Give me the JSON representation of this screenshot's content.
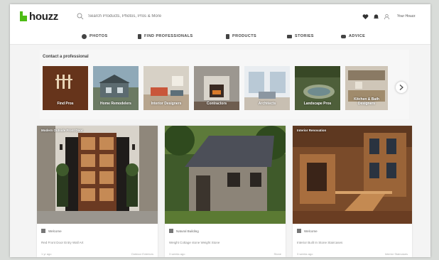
{
  "app": {
    "logo_text": "houzz",
    "search_placeholder": "Search Products, Photos, Pros & More"
  },
  "topbar": {
    "join_label": "Your Houzz",
    "icons": [
      "heart-icon",
      "bell-icon",
      "user-icon"
    ]
  },
  "nav": {
    "items": [
      {
        "label": "PHOTOS",
        "icon": "camera-icon"
      },
      {
        "label": "FIND PROFESSIONALS",
        "icon": "person-icon"
      },
      {
        "label": "PRODUCTS",
        "icon": "lamp-icon"
      },
      {
        "label": "STORIES",
        "icon": "book-icon"
      },
      {
        "label": "ADVICE",
        "icon": "chat-icon"
      }
    ]
  },
  "pros": {
    "title": "Contact a professional",
    "tiles": [
      {
        "label": "Find Pros"
      },
      {
        "label": "Home Remodelers"
      },
      {
        "label": "Interior Designers"
      },
      {
        "label": "Contractors"
      },
      {
        "label": "Architects"
      },
      {
        "label": "Landscape Pros"
      },
      {
        "label": "Kitchen & Bath Designers"
      }
    ]
  },
  "cards": [
    {
      "title": "Modern Outside Front Door",
      "author": "Welcome",
      "desc": "Red Front Door Entry Wall Art",
      "time": "1 yr ago",
      "meta": "Outdoor Exteriors"
    },
    {
      "title": "",
      "author": "Natural Building",
      "desc": "Weight Cottage stone Weight Stone",
      "time": "3 weeks ago",
      "meta": "Stone"
    },
    {
      "title": "Interior Renovation",
      "author": "Welcome",
      "desc": "Interior Built In Stone Staircases",
      "time": "3 weeks ago",
      "meta": "Interior Staircases"
    }
  ],
  "colors": {
    "brand_green": "#4dbc15"
  }
}
